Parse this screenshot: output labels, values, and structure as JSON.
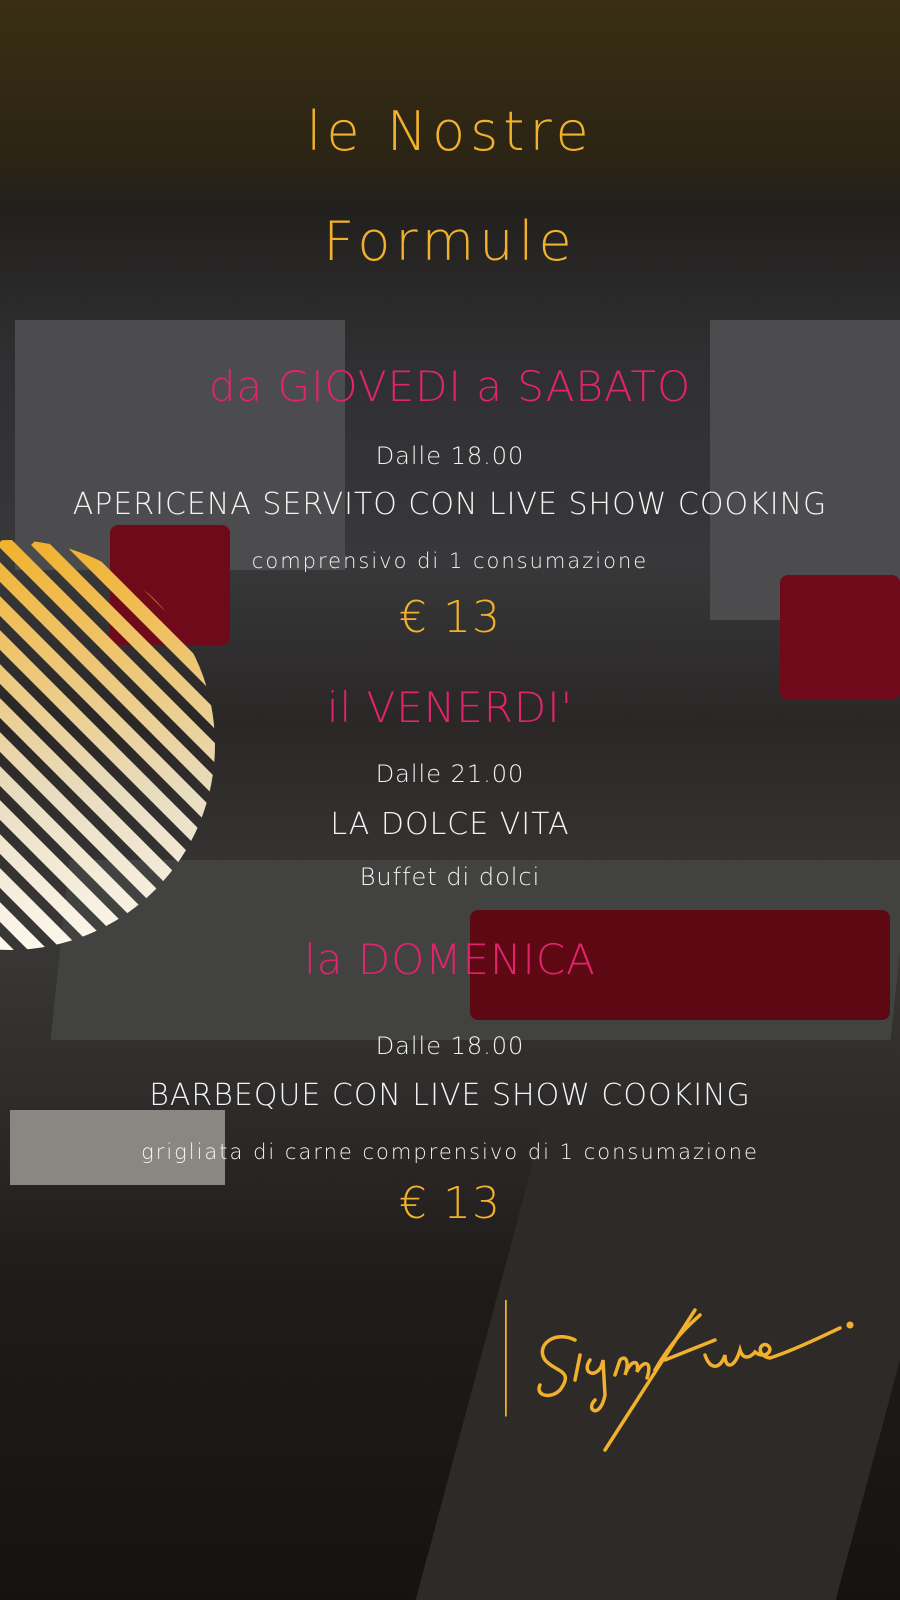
{
  "title": {
    "line1": "le Nostre",
    "line2": "Formule"
  },
  "colors": {
    "gold": "#f2b12c",
    "pink": "#e3236e",
    "text": "#f4f4f4"
  },
  "sections": [
    {
      "day": "da GIOVEDI a SABATO",
      "time": "Dalle 18.00",
      "name": "APERICENA SERVITO CON LIVE SHOW COOKING",
      "note": "comprensivo di 1 consumazione",
      "price": "€ 13"
    },
    {
      "day": "il VENERDI'",
      "time": "Dalle 21.00",
      "name": "LA DOLCE VITA",
      "note": "Buffet di dolci"
    },
    {
      "day": "la DOMENICA",
      "time": "Dalle 18.00",
      "name": "BARBEQUE CON LIVE SHOW COOKING",
      "note": "grigliata di carne comprensivo di 1 consumazione",
      "price": "€ 13"
    }
  ],
  "signature": "Signature."
}
